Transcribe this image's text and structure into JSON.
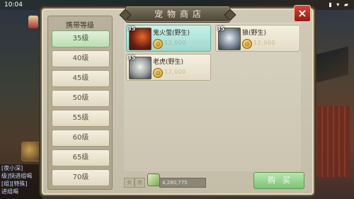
{
  "status_bar": {
    "time": "10:04",
    "icons": "▮ ▾ ▰"
  },
  "background": {
    "chat_lines": [
      "[夜小深]",
      "级]快进组喝",
      "[组][特殊]",
      "进组喝"
    ]
  },
  "shop": {
    "title": "宠物商店",
    "close_icon": "×",
    "sidebar": {
      "header": "携带等级",
      "levels": [
        "35级",
        "40级",
        "45级",
        "50级",
        "55级",
        "60级",
        "65级",
        "70级"
      ],
      "selected_index": 0
    },
    "pets": [
      {
        "level": "35",
        "name": "鬼火萤(野生)",
        "price": "12,000",
        "portrait": "firefly-portrait",
        "selected": true
      },
      {
        "level": "35",
        "name": "狼(野生)",
        "price": "12,000",
        "portrait": "wolf-portrait",
        "selected": false
      },
      {
        "level": "35",
        "name": "老虎(野生)",
        "price": "12,000",
        "portrait": "tiger-portrait",
        "selected": false
      }
    ],
    "currency": {
      "tag_left": "卖",
      "tag_right": "券",
      "value": "4,280,775",
      "icon": "money-icon"
    },
    "buy_label": "购买"
  },
  "colors": {
    "panel_bg": "#c9c3af",
    "selected_card": "#a8dcd0",
    "active_level": "#cfe8c8",
    "buy_button": "#8cc985",
    "close_button": "#c23a2e"
  }
}
